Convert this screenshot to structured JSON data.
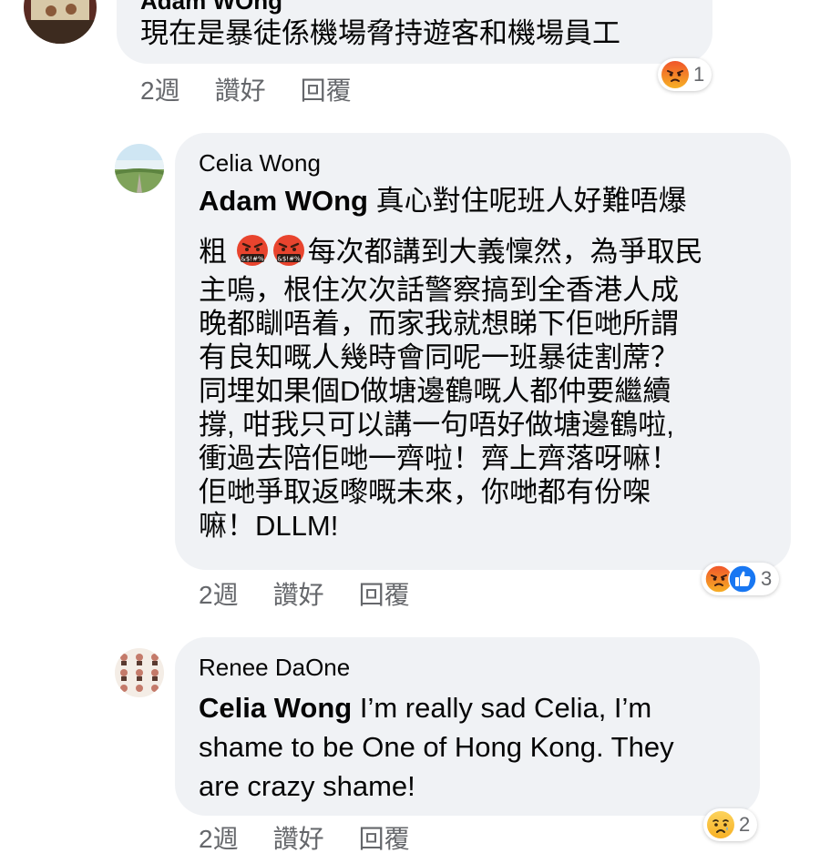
{
  "comments": [
    {
      "author": "Adam WOng",
      "mention": "",
      "text": "現在是暴徒係機場脅持遊客和機場員工",
      "time": "2週",
      "like_label": "讚好",
      "reply_label": "回覆",
      "reaction_count": "1",
      "reactions": [
        "angry-icon"
      ]
    },
    {
      "author": "Celia Wong",
      "mention": "Adam WOng",
      "lines": [
        " 真心對住呢班人好難唔爆",
        "粗",
        "每次都講到大義懍然，為爭取民",
        "主嗚，根住次次話警察搞到全香港人成",
        "晚都瞓唔着，而家我就想睇下佢哋所謂",
        "有良知嘅人幾時會同呢一班暴徒割蓆？",
        "同埋如果個D做塘邊鶴嘅人都仲要繼續",
        "撐, 咁我只可以講一句唔好做塘邊鶴啦,",
        "衝過去陪佢哋一齊啦！齊上齊落呀嘛！",
        "佢哋爭取返嚟嘅未來，你哋都有份㗎",
        "嘛！DLLM!"
      ],
      "time": "2週",
      "like_label": "讚好",
      "reply_label": "回覆",
      "reaction_count": "3",
      "reactions": [
        "angry-icon",
        "like-icon"
      ]
    },
    {
      "author": "Renee DaOne",
      "mention": "Celia Wong",
      "lines": [
        " I’m really sad Celia, I’m",
        "shame to be One of Hong Kong. They",
        "are crazy shame!"
      ],
      "time": "2週",
      "like_label": "讚好",
      "reply_label": "回覆",
      "reaction_count": "2",
      "reactions": [
        "sad-icon"
      ]
    }
  ],
  "colors": {
    "bubble": "#f0f2f5",
    "meta_text": "#65676b",
    "like_blue": "#1877f2",
    "angry_top": "#f0542a",
    "angry_bottom": "#f7b125"
  }
}
